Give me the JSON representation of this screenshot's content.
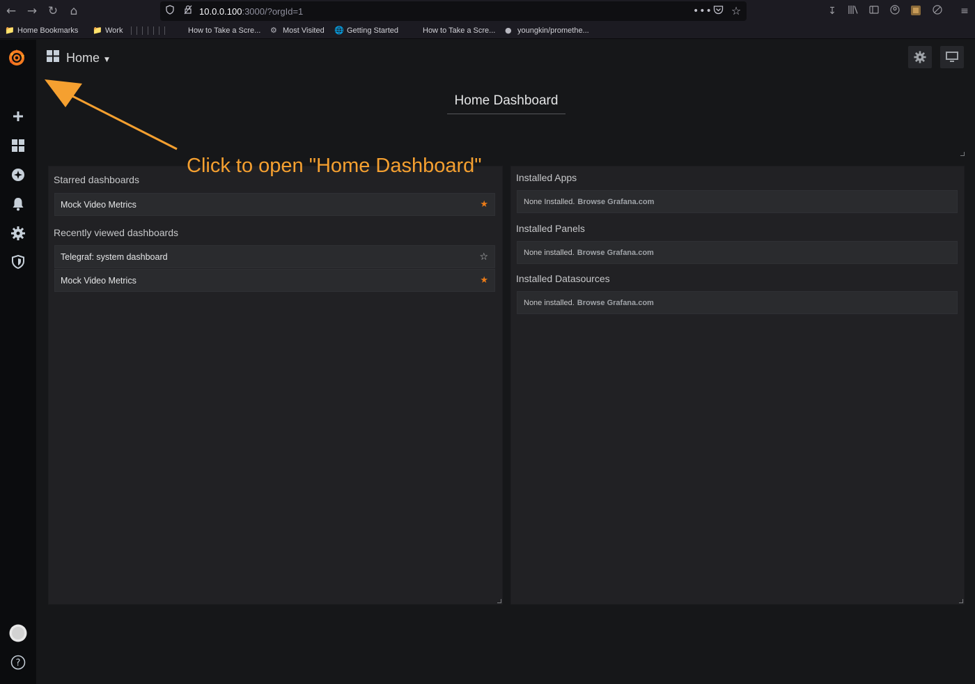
{
  "browser": {
    "url_host": "10.0.0.100",
    "url_path": ":3000/?orgId=1",
    "bookmarks": [
      {
        "label": "Home Bookmarks",
        "icon": "folder-icon"
      },
      {
        "label": "Work",
        "icon": "folder-icon"
      },
      {
        "label": "How to Take a Scre...",
        "icon": "page-icon"
      },
      {
        "label": "Most Visited",
        "icon": "gear-icon"
      },
      {
        "label": "Getting Started",
        "icon": "globe-icon"
      },
      {
        "label": "How to Take a Scre...",
        "icon": "page-icon"
      },
      {
        "label": "youngkin/promethe...",
        "icon": "github-icon"
      }
    ]
  },
  "dashnav": {
    "title": "Home"
  },
  "home": {
    "title": "Home Dashboard"
  },
  "left_panel": {
    "starred_heading": "Starred dashboards",
    "starred": [
      {
        "label": "Mock Video Metrics",
        "starred": true
      }
    ],
    "recent_heading": "Recently viewed dashboards",
    "recent": [
      {
        "label": "Telegraf: system dashboard",
        "starred": false
      },
      {
        "label": "Mock Video Metrics",
        "starred": true
      }
    ]
  },
  "right_panel": {
    "sections": [
      {
        "heading": "Installed Apps",
        "empty_text": "None Installed.",
        "link": "Browse Grafana.com"
      },
      {
        "heading": "Installed Panels",
        "empty_text": "None installed.",
        "link": "Browse Grafana.com"
      },
      {
        "heading": "Installed Datasources",
        "empty_text": "None installed.",
        "link": "Browse Grafana.com"
      }
    ]
  },
  "annotation": {
    "text": "Click to open \"Home Dashboard\""
  },
  "colors": {
    "accent_orange": "#eb7b18",
    "annotation": "#f5a030",
    "panel_bg": "#212124",
    "page_bg": "#161719",
    "sidemenu_bg": "#0b0c0e"
  }
}
